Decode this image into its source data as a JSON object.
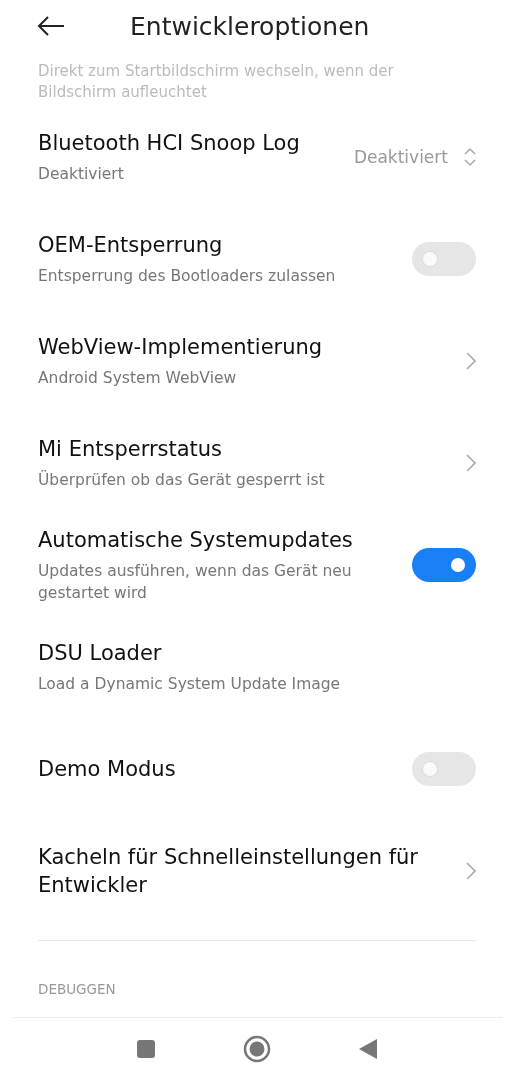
{
  "header": {
    "title": "Entwickleroptionen"
  },
  "top_fragment": {
    "description": "Direkt zum Startbildschirm wechseln, wenn der Bildschirm aufleuchtet"
  },
  "settings": [
    {
      "kind": "value",
      "title": "Bluetooth HCI Snoop Log",
      "description": "Deaktiviert",
      "value": "Deaktiviert"
    },
    {
      "kind": "toggle",
      "title": "OEM-Entsperrung",
      "description": "Entsperrung des Bootloaders zulassen",
      "on": false
    },
    {
      "kind": "link",
      "title": "WebView-Implementierung",
      "description": "Android System WebView"
    },
    {
      "kind": "link",
      "title": "Mi Entsperrstatus",
      "description": "Überprüfen ob das Gerät gesperrt ist"
    },
    {
      "kind": "toggle",
      "title": "Automatische Systemupdates",
      "description": "Updates ausführen, wenn das Gerät neu gestartet wird",
      "on": true
    },
    {
      "kind": "plain",
      "title": "DSU Loader",
      "description": "Load a Dynamic System Update Image"
    },
    {
      "kind": "toggle",
      "title": "Demo Modus",
      "on": false
    },
    {
      "kind": "link",
      "title": "Kacheln für Schnelleinstellungen für Entwickler"
    }
  ],
  "section_header": "DEBUGGEN"
}
